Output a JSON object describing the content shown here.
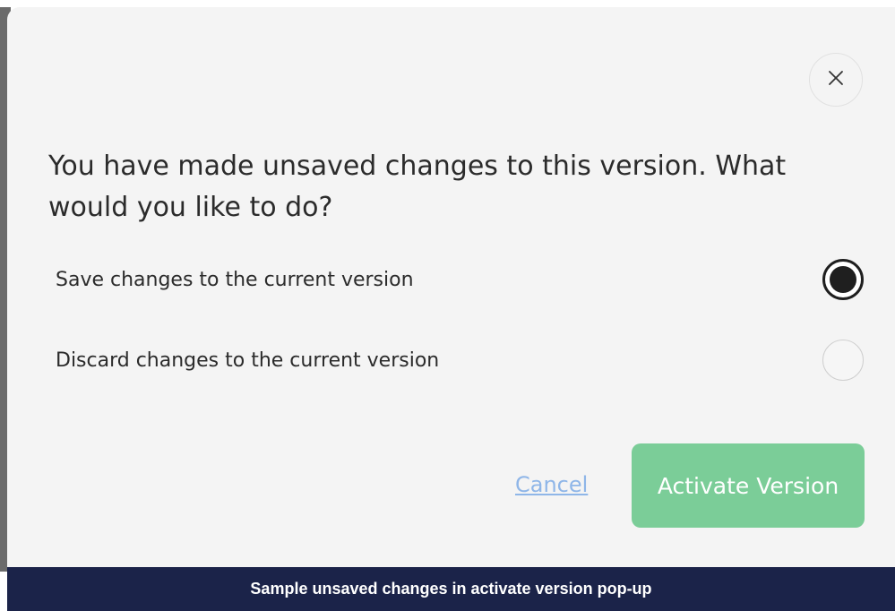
{
  "dialog": {
    "question": "You have made unsaved changes to this version. What would you like to do?",
    "close_icon": "close-icon",
    "options": [
      {
        "label": "Save changes to the current version",
        "selected": true
      },
      {
        "label": "Discard changes to the current version",
        "selected": false
      }
    ],
    "cancel_label": "Cancel",
    "activate_label": "Activate Version"
  },
  "caption": {
    "text": "Sample unsaved changes in activate version pop-up"
  },
  "colors": {
    "modal_bg": "#f4f4f4",
    "primary_button": "#7bcd98",
    "link": "#8fb6e8",
    "caption_bg": "#1b2349"
  }
}
